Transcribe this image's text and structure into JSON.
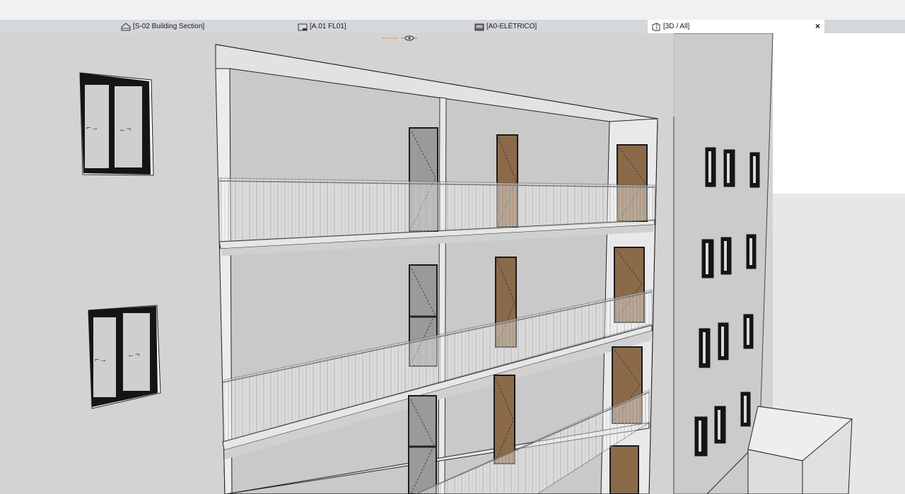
{
  "tabs": [
    {
      "label": "[S-02 Building Section]",
      "icon": "section-icon"
    },
    {
      "label": "[A.01 FL01]",
      "icon": "floor-plan-icon"
    },
    {
      "label": "[A0-ELÉTRICO]",
      "icon": "layout-icon"
    },
    {
      "label": "[3D / All]",
      "icon": "3d-view-icon",
      "active": true,
      "close": "×"
    }
  ],
  "colors": {
    "tab_bar": "#d4d7db",
    "active_tab": "#ffffff",
    "wall": "#d3d3d3",
    "wall_side": "#c8c8c8",
    "door_wood": "#8b6a4a",
    "door_glass": "#9a9a9a",
    "window_frame": "#151515",
    "sky": "#ffffff"
  }
}
